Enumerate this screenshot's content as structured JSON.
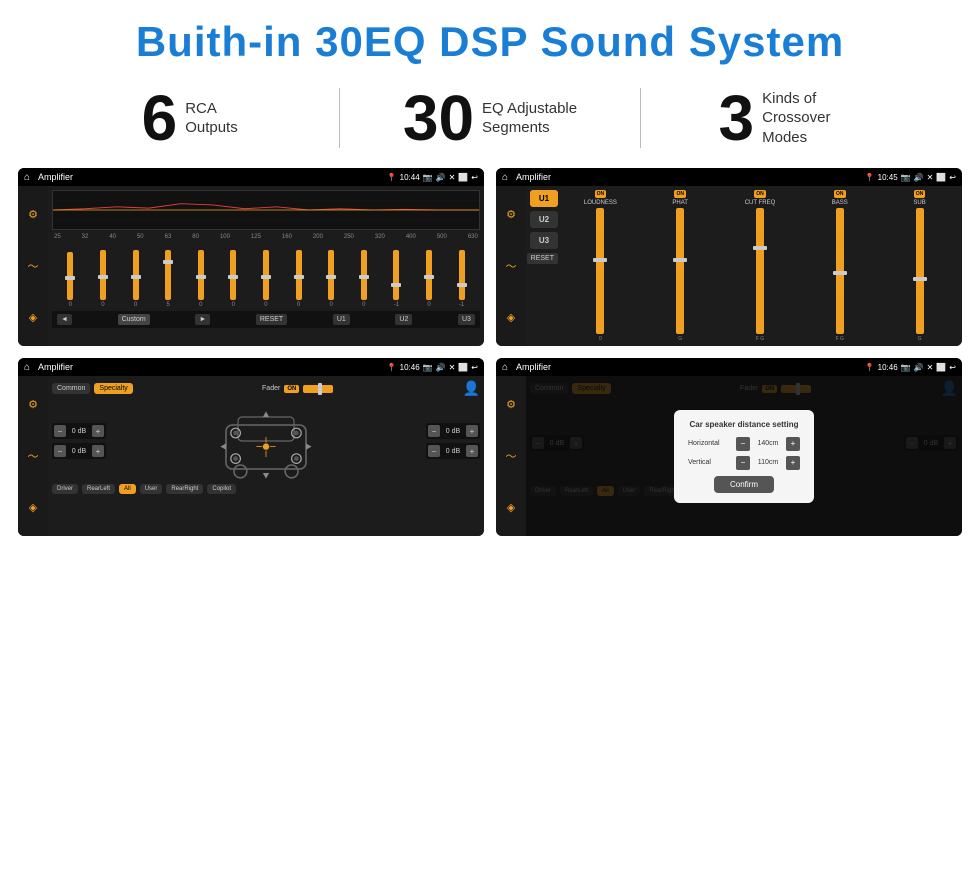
{
  "header": {
    "title": "Buith-in 30EQ DSP Sound System"
  },
  "stats": [
    {
      "number": "6",
      "desc_line1": "RCA",
      "desc_line2": "Outputs"
    },
    {
      "number": "30",
      "desc_line1": "EQ Adjustable",
      "desc_line2": "Segments"
    },
    {
      "number": "3",
      "desc_line1": "Kinds of",
      "desc_line2": "Crossover Modes"
    }
  ],
  "screens": {
    "eq": {
      "title": "Amplifier",
      "time": "10:44",
      "freq_labels": [
        "25",
        "32",
        "40",
        "50",
        "63",
        "80",
        "100",
        "125",
        "160",
        "200",
        "250",
        "320",
        "400",
        "500",
        "630"
      ],
      "slider_values": [
        "0",
        "0",
        "0",
        "5",
        "0",
        "0",
        "0",
        "0",
        "0",
        "0",
        "-1",
        "0",
        "-1"
      ],
      "nav_labels": [
        "◄",
        "Custom",
        "►",
        "RESET",
        "U1",
        "U2",
        "U3"
      ]
    },
    "crossover": {
      "title": "Amplifier",
      "time": "10:45",
      "presets": [
        "U1",
        "U2",
        "U3"
      ],
      "channels": [
        "LOUDNESS",
        "PHAT",
        "CUT FREQ",
        "BASS",
        "SUB"
      ],
      "on_labels": [
        "ON",
        "ON",
        "ON",
        "ON",
        "ON"
      ],
      "reset_label": "RESET"
    },
    "fader": {
      "title": "Amplifier",
      "time": "10:46",
      "tabs": [
        "Common",
        "Specialty"
      ],
      "fader_label": "Fader",
      "db_values": [
        "0 dB",
        "0 dB",
        "0 dB",
        "0 dB"
      ],
      "bottom_btns": [
        "Driver",
        "RearLeft",
        "All",
        "User",
        "RearRight",
        "Copilot"
      ]
    },
    "distance": {
      "title": "Amplifier",
      "time": "10:46",
      "tabs": [
        "Common",
        "Specialty"
      ],
      "dialog_title": "Car speaker distance setting",
      "horizontal_label": "Horizontal",
      "horizontal_value": "140cm",
      "vertical_label": "Vertical",
      "vertical_value": "110cm",
      "confirm_label": "Confirm",
      "db_values": [
        "0 dB",
        "0 dB"
      ],
      "bottom_btns": [
        "Driver",
        "RearLeft",
        "All",
        "User",
        "RearRight",
        "Copilot"
      ]
    }
  },
  "colors": {
    "accent": "#1a7fd4",
    "orange": "#f0a020",
    "dark_bg": "#111111",
    "screen_bg": "#1c1c1c"
  }
}
